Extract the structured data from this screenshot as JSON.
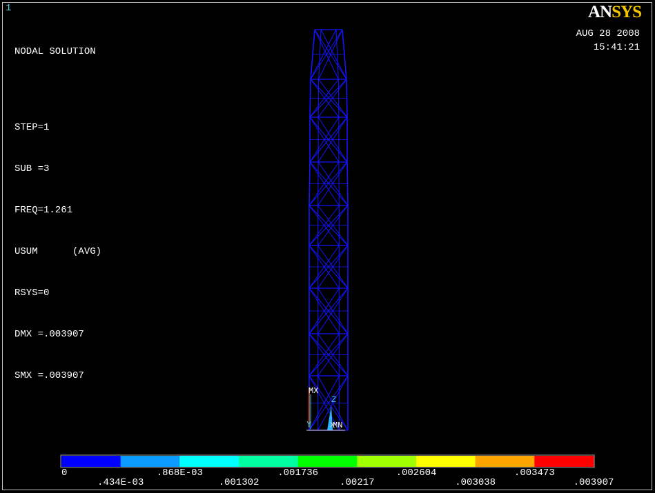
{
  "window": {
    "number": "1"
  },
  "info": {
    "title": "NODAL SOLUTION",
    "step": "STEP=1",
    "sub": "SUB =3",
    "freq": "FREQ=1.261",
    "item": "USUM      (AVG)",
    "rsys": "RSYS=0",
    "dmx": "DMX =.003907",
    "smx": "SMX =.003907"
  },
  "logo": {
    "an": "AN",
    "sys": "SYS"
  },
  "datetime": {
    "date": "AUG 28 2008",
    "time": "15:41:21"
  },
  "triad": {
    "mx": "MX",
    "z": "Z",
    "y": "Y",
    "x": "X",
    "mn": "MN"
  },
  "legend": {
    "colors": [
      "#0000ff",
      "#0b9bff",
      "#00ffff",
      "#00ffa0",
      "#00ff00",
      "#a0ff00",
      "#ffff00",
      "#ffa500",
      "#ff0000"
    ],
    "labels_bottom": [
      "0",
      ".868E-03",
      ".001736",
      ".002604",
      ".003473"
    ],
    "labels_top": [
      ".434E-03",
      ".001302",
      ".00217",
      ".003038",
      ".003907"
    ]
  },
  "colors": {
    "model_wire": "#1414ff",
    "frame": "#c8c8c8",
    "window_number": "#5ad1e6",
    "logo_sys": "#f2c500"
  }
}
